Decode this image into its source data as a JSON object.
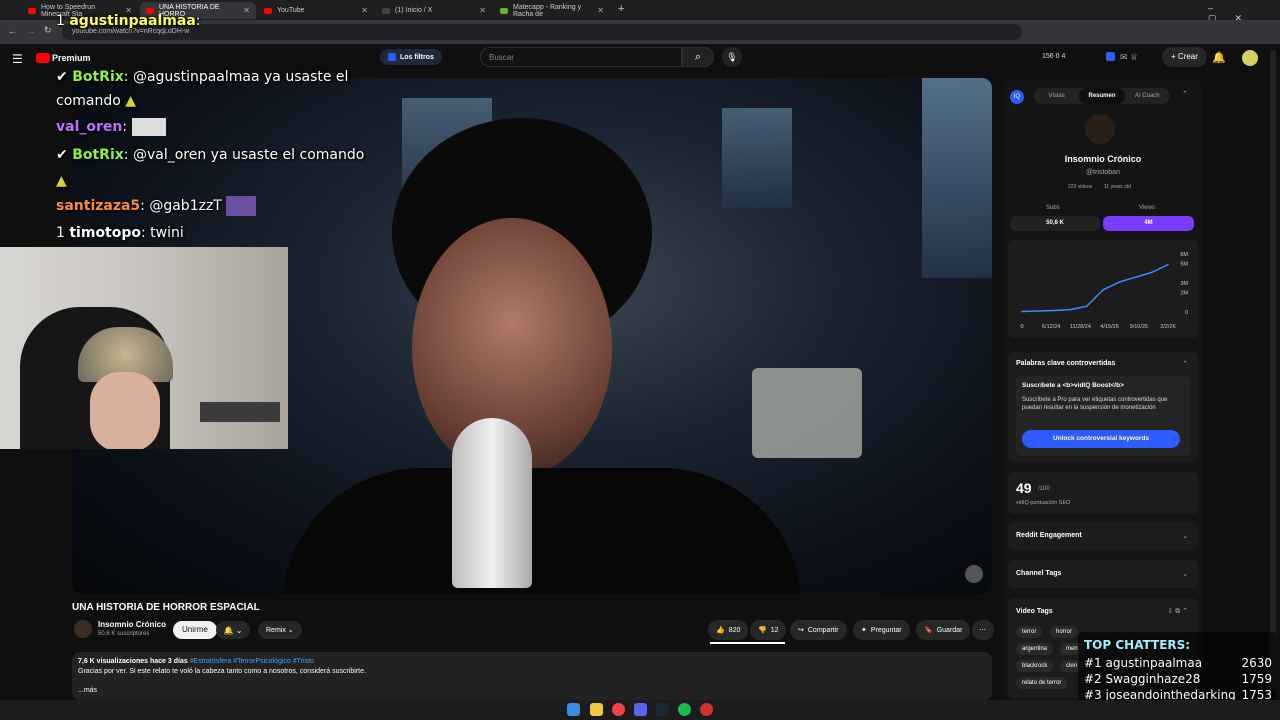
{
  "browser": {
    "tabs": [
      {
        "label": "How to Speedrun Minecraft Sta",
        "active": false
      },
      {
        "label": "UNA HISTORIA DE HORRO",
        "active": true
      },
      {
        "label": "YouTube",
        "active": false
      },
      {
        "label": "(1) Inicio / X",
        "active": false
      },
      {
        "label": "Matecapp - Ranking y Racha de",
        "active": false
      }
    ],
    "new_tab": "+",
    "url": "youtube.com/watch?v=nRcqqLoDH-w"
  },
  "yt_header": {
    "logo": "Premium",
    "filters": "Los filtros",
    "search_placeholder": "Buscar",
    "stats": "156   0   4",
    "create": "Crear"
  },
  "stream_chat": [
    {
      "badges": "1 ",
      "user": "agustinpaalmaa",
      "user_color": "#ffff55",
      "msg": ":"
    },
    {
      "badges": "✔ ",
      "user": "BotRix",
      "user_color": "#8ef04a",
      "msg": ": @agustinpaalmaa ya usaste el"
    },
    {
      "badges": "",
      "user": "",
      "user_color": "#fff",
      "msg": "comando"
    },
    {
      "badges": "",
      "user": "val_oren",
      "user_color": "#c071ff",
      "msg": ":"
    },
    {
      "badges": "✔ ",
      "user": "BotRix",
      "user_color": "#8ef04a",
      "msg": ": @val_oren ya usaste el comando"
    },
    {
      "badges": "",
      "user": "santizaza5",
      "user_color": "#ff8a3d",
      "msg": ": @gab1zzT"
    },
    {
      "badges": "1 ",
      "user": "timotopo",
      "user_color": "#ffffff",
      "msg": ": twini"
    }
  ],
  "video": {
    "title": "UNA HISTORIA DE HORROR ESPACIAL",
    "channel": "Insomnio Crónico",
    "subs": "50,6 K suscriptores",
    "join": "Unirme",
    "remix": "Remix",
    "likes": "820",
    "dislikes": "12",
    "share": "Compartir",
    "ask": "Preguntar",
    "save": "Guardar",
    "desc_meta": "7,6 K visualizaciones  hace 3 días",
    "desc_tags": "#Estratósfera #TerrorPsicológico #Tristo",
    "desc_text": "Gracias por ver. Si este relato te voló la cabeza tanto como a nosotros, considerá suscribirte.",
    "more": "...más"
  },
  "vidiq": {
    "tabs": [
      "Vistas",
      "Resumen",
      "AI Coach"
    ],
    "channel_name": "Insomnio Crónico",
    "handle": "@tristoban",
    "videos": "222 videos",
    "age": "11 years old",
    "subs_label": "Subs",
    "views_label": "Views",
    "subs_value": "50,6 K",
    "views_value": "4M",
    "keywords_title": "Palabras clave controvertidas",
    "boost_title": "Suscríbete a <b>vidIQ Boost</b>",
    "boost_text": "Suscríbete a Pro para ver etiquetas controvertidas que puedan resultar en la suspensión de monetización",
    "unlock": "Unlock controversial keywords",
    "score": "49",
    "score_max": "/100",
    "score_label": "vidIQ puntuación SEO",
    "reddit": "Reddit Engagement",
    "channel_tags": "Channel Tags",
    "video_tags": "Video Tags",
    "tags": [
      "terror",
      "horror",
      "argentina",
      "men",
      "blackrock",
      "clen",
      "relato de terror"
    ]
  },
  "chart_data": {
    "type": "line",
    "title": "",
    "xlabel": "",
    "ylabel": "",
    "x": [
      "0",
      "6/12/24",
      "11/28/24",
      "4/15/25",
      "9/10/25",
      "2/2/26"
    ],
    "y_ticks": [
      "0",
      "2M",
      "3M",
      "5M",
      "6M"
    ],
    "series": [
      {
        "values": [
          0.05,
          0.1,
          0.15,
          0.25,
          0.6,
          2.3,
          3.1,
          3.6,
          4.1,
          4.9
        ]
      }
    ],
    "ylim": [
      0,
      6
    ],
    "grid": false
  },
  "top_chatters": {
    "title": "TOP CHATTERS:",
    "rows": [
      {
        "rank": "#1",
        "name": "agustinpaalmaa",
        "count": "2630"
      },
      {
        "rank": "#2",
        "name": "Swagginhaze28",
        "count": "1759"
      },
      {
        "rank": "#3",
        "name": "joseandointhedarking",
        "count": "1753"
      }
    ]
  },
  "colors": {
    "accent": "#7b3cff",
    "vidiq_blue": "#2d5bff",
    "youtube_red": "#ff0000"
  }
}
